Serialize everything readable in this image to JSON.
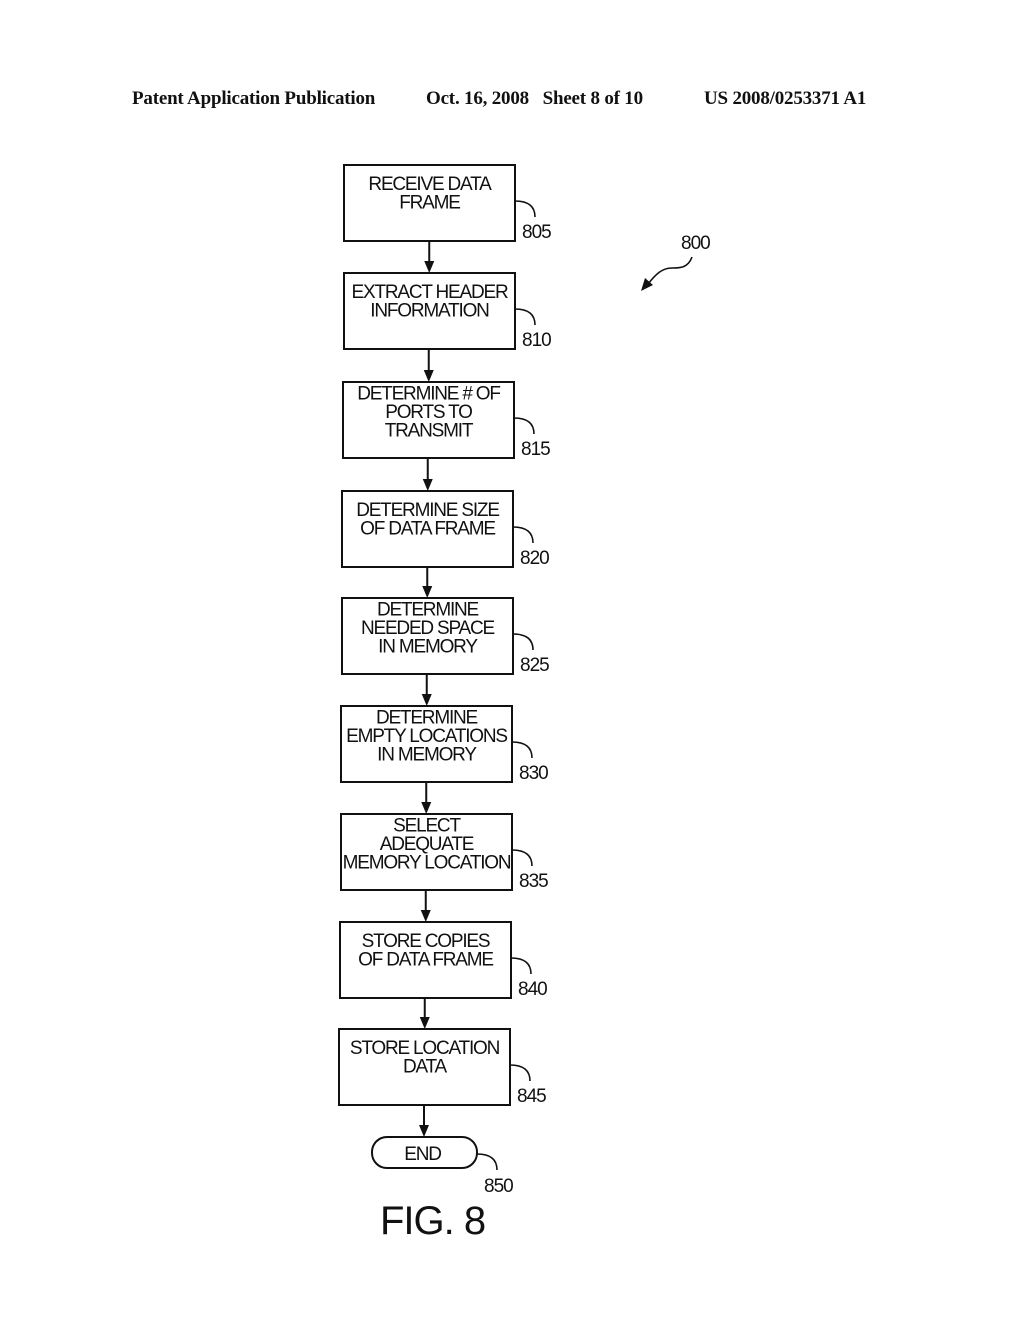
{
  "header": {
    "publication": "Patent Application Publication",
    "date_sheet": "Oct. 16, 2008   Sheet 8 of 10",
    "patent_number": "US 2008/0253371 A1"
  },
  "figure": {
    "label": "FIG. 8",
    "reference": "800"
  },
  "steps": [
    {
      "ref": "805",
      "lines": [
        "RECEIVE DATA",
        "FRAME"
      ]
    },
    {
      "ref": "810",
      "lines": [
        "EXTRACT HEADER",
        "INFORMATION"
      ]
    },
    {
      "ref": "815",
      "lines": [
        "DETERMINE # OF",
        "PORTS TO",
        "TRANSMIT"
      ]
    },
    {
      "ref": "820",
      "lines": [
        "DETERMINE SIZE",
        "OF DATA FRAME"
      ]
    },
    {
      "ref": "825",
      "lines": [
        "DETERMINE",
        "NEEDED SPACE",
        "IN MEMORY"
      ]
    },
    {
      "ref": "830",
      "lines": [
        "DETERMINE",
        "EMPTY LOCATIONS",
        "IN MEMORY"
      ]
    },
    {
      "ref": "835",
      "lines": [
        "SELECT",
        "ADEQUATE",
        "MEMORY LOCATION"
      ]
    },
    {
      "ref": "840",
      "lines": [
        "STORE COPIES",
        "OF DATA FRAME"
      ]
    },
    {
      "ref": "845",
      "lines": [
        "STORE LOCATION",
        "DATA"
      ]
    }
  ],
  "terminal": {
    "ref": "850",
    "label": "END"
  }
}
